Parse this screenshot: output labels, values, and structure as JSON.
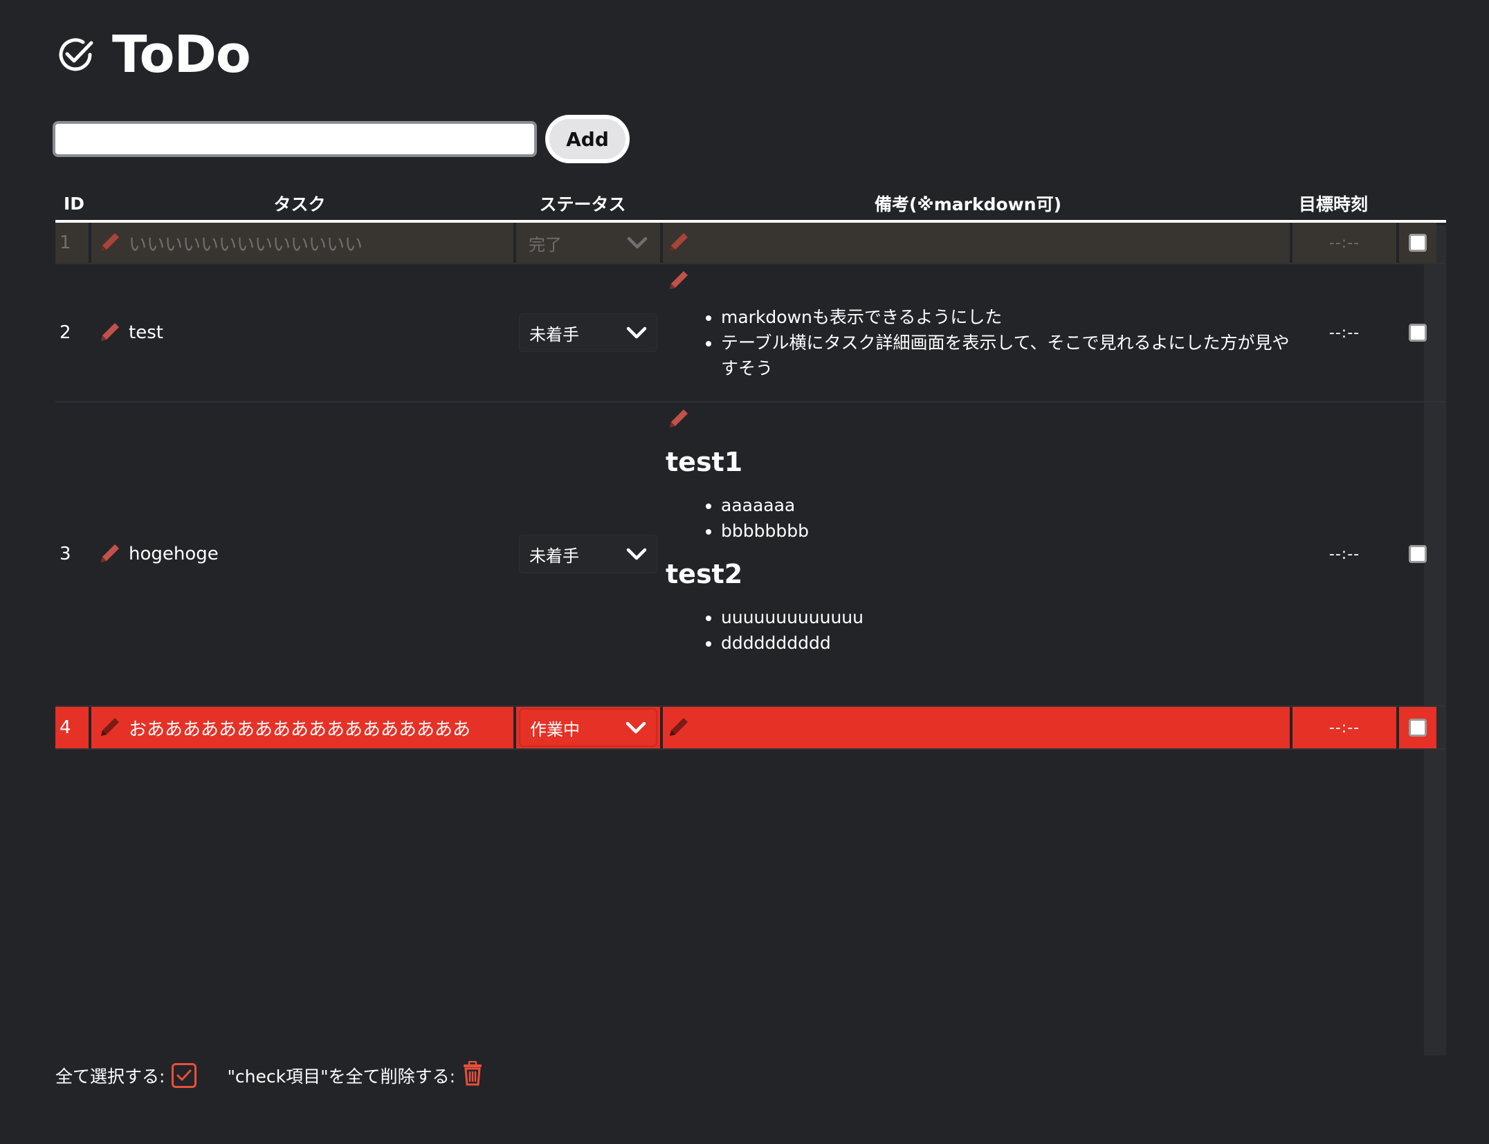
{
  "app": {
    "title": "ToDo"
  },
  "add_form": {
    "input_value": "",
    "button_label": "Add"
  },
  "table": {
    "headers": {
      "id": "ID",
      "task": "タスク",
      "status": "ステータス",
      "memo": "備考(※markdown可)",
      "deadline": "目標時刻"
    },
    "rows": [
      {
        "id": "1",
        "task": "いいいいいいいいいいいいい",
        "status": "完了",
        "deadline": "--:--",
        "checked": false,
        "state": "done"
      },
      {
        "id": "2",
        "task": "test",
        "status": "未着手",
        "deadline": "--:--",
        "checked": false,
        "memo_items": [
          "markdownも表示できるようにした",
          "テーブル横にタスク詳細画面を表示して、そこで見れるよにした方が見やすそう"
        ]
      },
      {
        "id": "3",
        "task": "hogehoge",
        "status": "未着手",
        "deadline": "--:--",
        "checked": false,
        "memo_sections": [
          {
            "heading": "test1",
            "items": [
              "aaaaaaa",
              "bbbbbbbb"
            ]
          },
          {
            "heading": "test2",
            "items": [
              "uuuuuuuuuuuuu",
              "dddddddddd"
            ]
          }
        ]
      },
      {
        "id": "4",
        "task": "おああああああああああああああああああ",
        "status": "作業中",
        "deadline": "--:--",
        "checked": false,
        "state": "in-progress"
      }
    ]
  },
  "footer": {
    "select_all_label": "全て選択する:",
    "delete_checked_label": "\"check項目\"を全て削除する:"
  },
  "colors": {
    "background": "#222428",
    "done_row": "#38342f",
    "in_progress_row": "#e63126",
    "accent": "#e8503b"
  },
  "icons": {
    "logo": "check-circle-icon",
    "edit": "pencil-icon",
    "dropdown": "chevron-down-icon",
    "select_all": "checkbox-checked-icon",
    "delete": "trash-icon"
  }
}
